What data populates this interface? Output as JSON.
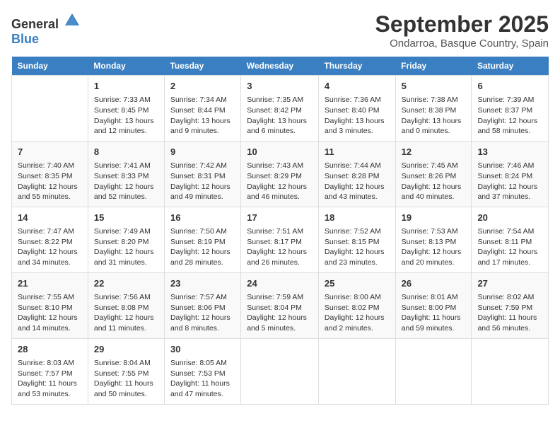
{
  "header": {
    "logo_general": "General",
    "logo_blue": "Blue",
    "month": "September 2025",
    "location": "Ondarroa, Basque Country, Spain"
  },
  "days_of_week": [
    "Sunday",
    "Monday",
    "Tuesday",
    "Wednesday",
    "Thursday",
    "Friday",
    "Saturday"
  ],
  "weeks": [
    [
      {
        "day": "",
        "content": ""
      },
      {
        "day": "1",
        "content": "Sunrise: 7:33 AM\nSunset: 8:45 PM\nDaylight: 13 hours\nand 12 minutes."
      },
      {
        "day": "2",
        "content": "Sunrise: 7:34 AM\nSunset: 8:44 PM\nDaylight: 13 hours\nand 9 minutes."
      },
      {
        "day": "3",
        "content": "Sunrise: 7:35 AM\nSunset: 8:42 PM\nDaylight: 13 hours\nand 6 minutes."
      },
      {
        "day": "4",
        "content": "Sunrise: 7:36 AM\nSunset: 8:40 PM\nDaylight: 13 hours\nand 3 minutes."
      },
      {
        "day": "5",
        "content": "Sunrise: 7:38 AM\nSunset: 8:38 PM\nDaylight: 13 hours\nand 0 minutes."
      },
      {
        "day": "6",
        "content": "Sunrise: 7:39 AM\nSunset: 8:37 PM\nDaylight: 12 hours\nand 58 minutes."
      }
    ],
    [
      {
        "day": "7",
        "content": "Sunrise: 7:40 AM\nSunset: 8:35 PM\nDaylight: 12 hours\nand 55 minutes."
      },
      {
        "day": "8",
        "content": "Sunrise: 7:41 AM\nSunset: 8:33 PM\nDaylight: 12 hours\nand 52 minutes."
      },
      {
        "day": "9",
        "content": "Sunrise: 7:42 AM\nSunset: 8:31 PM\nDaylight: 12 hours\nand 49 minutes."
      },
      {
        "day": "10",
        "content": "Sunrise: 7:43 AM\nSunset: 8:29 PM\nDaylight: 12 hours\nand 46 minutes."
      },
      {
        "day": "11",
        "content": "Sunrise: 7:44 AM\nSunset: 8:28 PM\nDaylight: 12 hours\nand 43 minutes."
      },
      {
        "day": "12",
        "content": "Sunrise: 7:45 AM\nSunset: 8:26 PM\nDaylight: 12 hours\nand 40 minutes."
      },
      {
        "day": "13",
        "content": "Sunrise: 7:46 AM\nSunset: 8:24 PM\nDaylight: 12 hours\nand 37 minutes."
      }
    ],
    [
      {
        "day": "14",
        "content": "Sunrise: 7:47 AM\nSunset: 8:22 PM\nDaylight: 12 hours\nand 34 minutes."
      },
      {
        "day": "15",
        "content": "Sunrise: 7:49 AM\nSunset: 8:20 PM\nDaylight: 12 hours\nand 31 minutes."
      },
      {
        "day": "16",
        "content": "Sunrise: 7:50 AM\nSunset: 8:19 PM\nDaylight: 12 hours\nand 28 minutes."
      },
      {
        "day": "17",
        "content": "Sunrise: 7:51 AM\nSunset: 8:17 PM\nDaylight: 12 hours\nand 26 minutes."
      },
      {
        "day": "18",
        "content": "Sunrise: 7:52 AM\nSunset: 8:15 PM\nDaylight: 12 hours\nand 23 minutes."
      },
      {
        "day": "19",
        "content": "Sunrise: 7:53 AM\nSunset: 8:13 PM\nDaylight: 12 hours\nand 20 minutes."
      },
      {
        "day": "20",
        "content": "Sunrise: 7:54 AM\nSunset: 8:11 PM\nDaylight: 12 hours\nand 17 minutes."
      }
    ],
    [
      {
        "day": "21",
        "content": "Sunrise: 7:55 AM\nSunset: 8:10 PM\nDaylight: 12 hours\nand 14 minutes."
      },
      {
        "day": "22",
        "content": "Sunrise: 7:56 AM\nSunset: 8:08 PM\nDaylight: 12 hours\nand 11 minutes."
      },
      {
        "day": "23",
        "content": "Sunrise: 7:57 AM\nSunset: 8:06 PM\nDaylight: 12 hours\nand 8 minutes."
      },
      {
        "day": "24",
        "content": "Sunrise: 7:59 AM\nSunset: 8:04 PM\nDaylight: 12 hours\nand 5 minutes."
      },
      {
        "day": "25",
        "content": "Sunrise: 8:00 AM\nSunset: 8:02 PM\nDaylight: 12 hours\nand 2 minutes."
      },
      {
        "day": "26",
        "content": "Sunrise: 8:01 AM\nSunset: 8:00 PM\nDaylight: 11 hours\nand 59 minutes."
      },
      {
        "day": "27",
        "content": "Sunrise: 8:02 AM\nSunset: 7:59 PM\nDaylight: 11 hours\nand 56 minutes."
      }
    ],
    [
      {
        "day": "28",
        "content": "Sunrise: 8:03 AM\nSunset: 7:57 PM\nDaylight: 11 hours\nand 53 minutes."
      },
      {
        "day": "29",
        "content": "Sunrise: 8:04 AM\nSunset: 7:55 PM\nDaylight: 11 hours\nand 50 minutes."
      },
      {
        "day": "30",
        "content": "Sunrise: 8:05 AM\nSunset: 7:53 PM\nDaylight: 11 hours\nand 47 minutes."
      },
      {
        "day": "",
        "content": ""
      },
      {
        "day": "",
        "content": ""
      },
      {
        "day": "",
        "content": ""
      },
      {
        "day": "",
        "content": ""
      }
    ]
  ]
}
